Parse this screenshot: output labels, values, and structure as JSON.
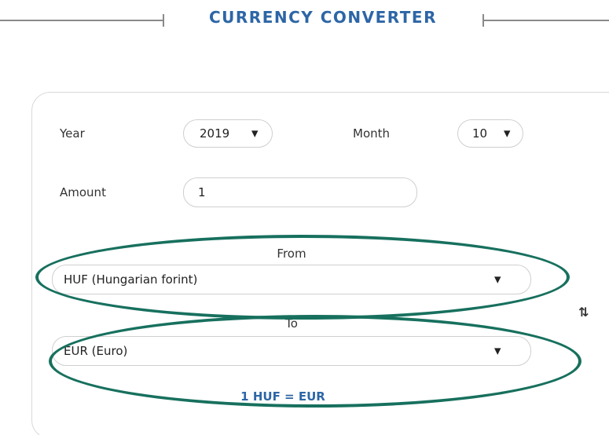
{
  "header": {
    "title": "CURRENCY CONVERTER"
  },
  "form": {
    "year_label": "Year",
    "year_value": "2019",
    "month_label": "Month",
    "month_value": "10",
    "amount_label": "Amount",
    "amount_value": "1",
    "from_label": "From",
    "from_value": "HUF (Hungarian forint)",
    "to_label": "To",
    "to_value": "EUR (Euro)",
    "result": "1 HUF = EUR"
  },
  "icons": {
    "caret": "▼",
    "swap": "⇅"
  },
  "colors": {
    "title": "#2d66a6",
    "highlight": "#17705e",
    "border": "#d9d9d9"
  }
}
